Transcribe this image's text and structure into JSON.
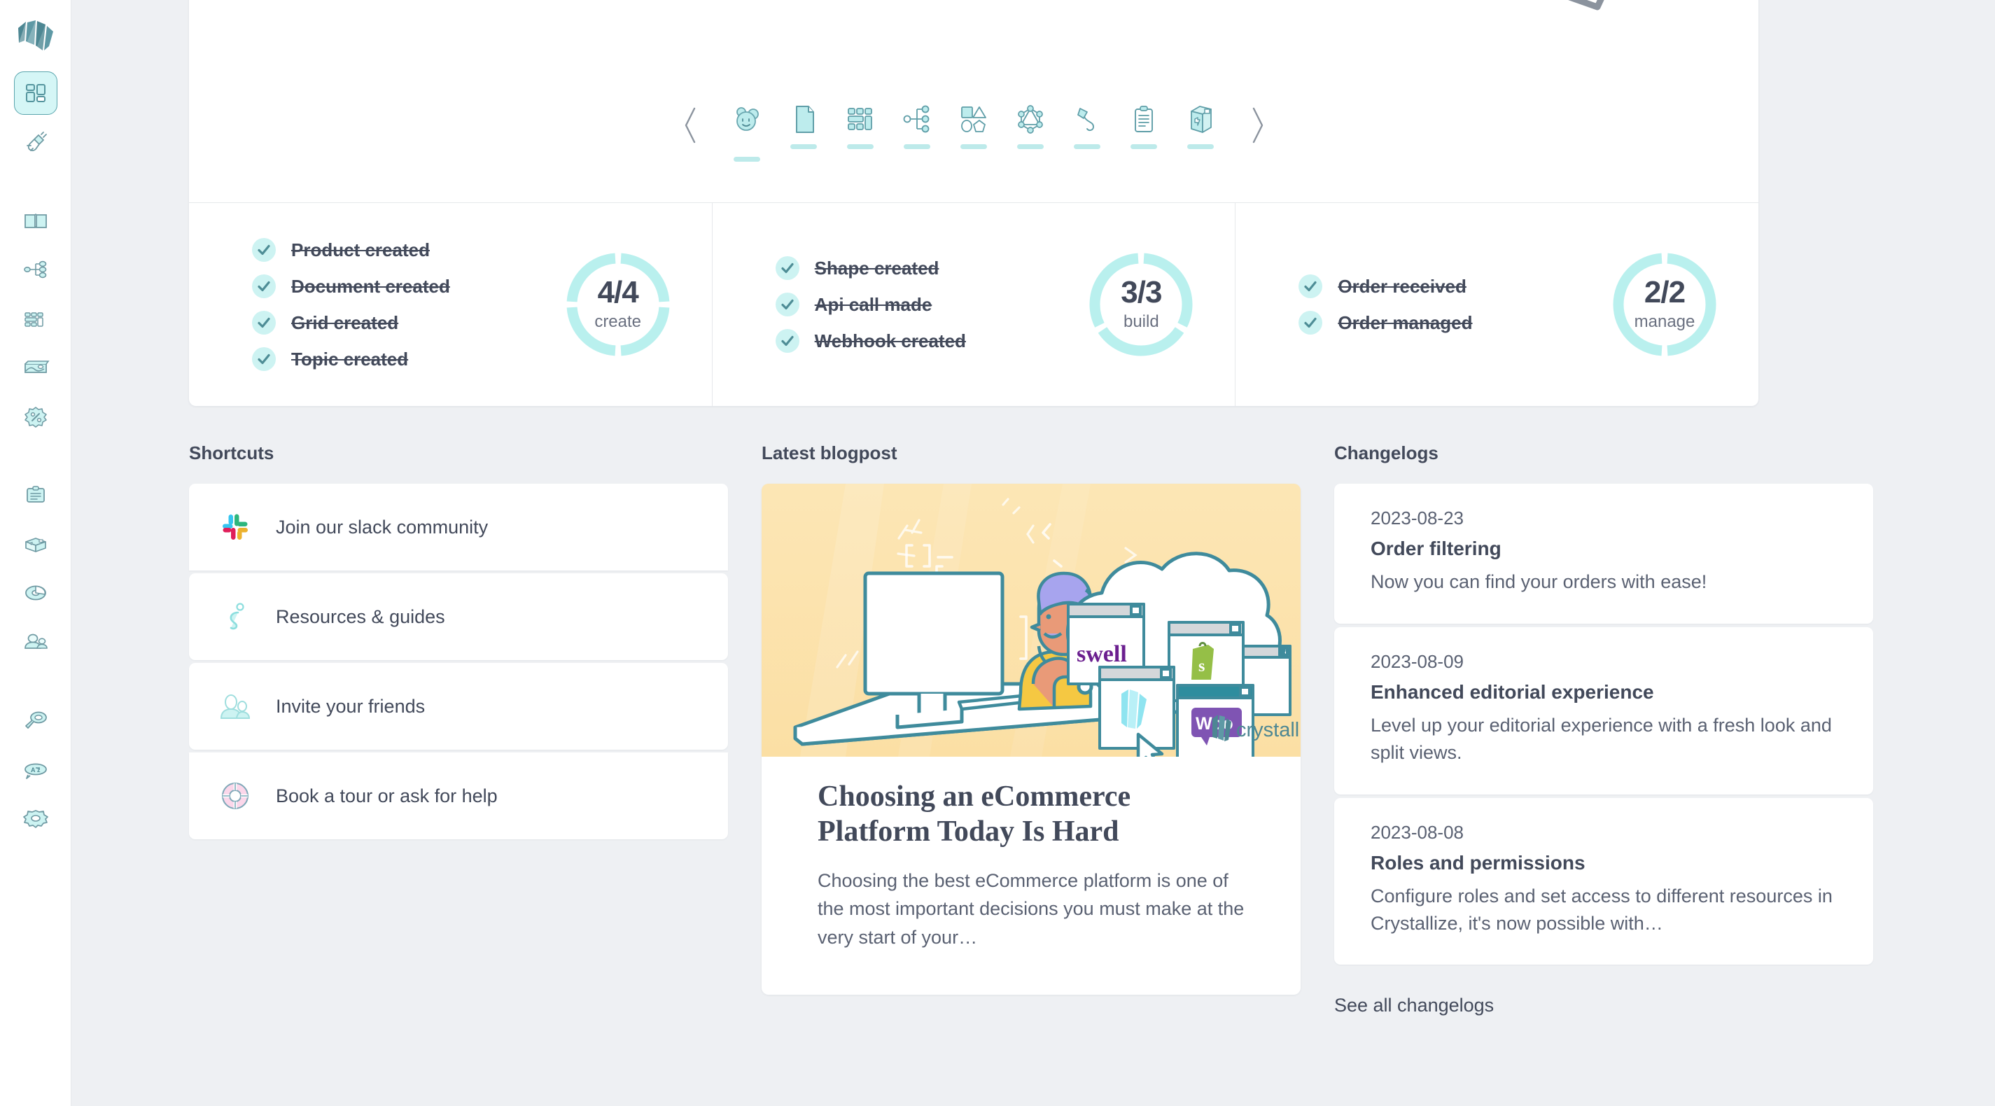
{
  "theme": {
    "page_bg": "#eef0f3",
    "card_bg": "#ffffff",
    "accent": "#7fd4d4",
    "accent_light": "#cdf3f2",
    "accent_dark": "#4f8f98",
    "text_dark": "#42495a",
    "text_muted": "#5a6172",
    "ring_filled": "#b9f0ee"
  },
  "sidebar": {
    "logo_name": "crystallize-logo",
    "items": [
      {
        "name": "dashboard",
        "icon": "dashboard-grid-icon",
        "active": true
      },
      {
        "name": "connections",
        "icon": "plug-icon",
        "active": false
      },
      {
        "name": "catalogue",
        "icon": "book-icon",
        "active": false
      },
      {
        "name": "topics",
        "icon": "topic-tree-icon",
        "active": false
      },
      {
        "name": "grids",
        "icon": "grid-layout-icon",
        "active": false
      },
      {
        "name": "media",
        "icon": "image-icon",
        "active": false
      },
      {
        "name": "discounts",
        "icon": "discount-badge-icon",
        "active": false
      },
      {
        "name": "orders",
        "icon": "clipboard-icon",
        "active": false
      },
      {
        "name": "shipping",
        "icon": "box-icon",
        "active": false
      },
      {
        "name": "analytics",
        "icon": "pie-chart-icon",
        "active": false
      },
      {
        "name": "customers",
        "icon": "people-icon",
        "active": false
      },
      {
        "name": "search",
        "icon": "magnifier-icon",
        "active": false
      },
      {
        "name": "translations",
        "icon": "language-az-icon",
        "active": false
      },
      {
        "name": "settings",
        "icon": "gear-icon",
        "active": false
      }
    ]
  },
  "onboarding": {
    "prev_label": "‹",
    "next_label": "›",
    "prev_icon": "chevron-left-icon",
    "next_icon": "chevron-right-icon",
    "tabs": [
      {
        "name": "product",
        "icon": "product-face-icon",
        "active": true
      },
      {
        "name": "document",
        "icon": "document-icon",
        "active": false
      },
      {
        "name": "grid",
        "icon": "grid-icon",
        "active": false
      },
      {
        "name": "topic",
        "icon": "topic-map-icon",
        "active": false
      },
      {
        "name": "shape",
        "icon": "shapes-icon",
        "active": false
      },
      {
        "name": "graphql",
        "icon": "graphql-icon",
        "active": false
      },
      {
        "name": "webhook",
        "icon": "hook-icon",
        "active": false
      },
      {
        "name": "order",
        "icon": "clipboard-order-icon",
        "active": false
      },
      {
        "name": "delivery",
        "icon": "package-box-icon",
        "active": false
      }
    ],
    "columns": [
      {
        "key": "create",
        "label": "create",
        "fraction": "4/4",
        "completed": 4,
        "total": 4,
        "tasks": [
          {
            "label": "Product created",
            "done": true
          },
          {
            "label": "Document created",
            "done": true
          },
          {
            "label": "Grid created",
            "done": true
          },
          {
            "label": "Topic created",
            "done": true
          }
        ]
      },
      {
        "key": "build",
        "label": "build",
        "fraction": "3/3",
        "completed": 3,
        "total": 3,
        "tasks": [
          {
            "label": "Shape created",
            "done": true
          },
          {
            "label": "Api call made",
            "done": true
          },
          {
            "label": "Webhook created",
            "done": true
          }
        ]
      },
      {
        "key": "manage",
        "label": "manage",
        "fraction": "2/2",
        "completed": 2,
        "total": 2,
        "tasks": [
          {
            "label": "Order received",
            "done": true
          },
          {
            "label": "Order managed",
            "done": true
          }
        ]
      }
    ]
  },
  "shortcuts": {
    "title": "Shortcuts",
    "items": [
      {
        "label": "Join our slack community",
        "icon": "slack-icon"
      },
      {
        "label": "Resources & guides",
        "icon": "question-mark-icon"
      },
      {
        "label": "Invite your friends",
        "icon": "people-icon"
      },
      {
        "label": "Book a tour or ask for help",
        "icon": "life-ring-icon"
      }
    ]
  },
  "blogpost": {
    "title": "Latest blogpost",
    "post_title": "Choosing an eCommerce Platform Today Is Hard",
    "excerpt": "Choosing the best eCommerce platform is one of the most important decisions you must make at the very start of your…",
    "image_alt": "illustration-man-at-desk-thinking-about-ecommerce-platforms",
    "image_logos": [
      "swell",
      "shopify",
      "crystallize",
      "woocommerce"
    ],
    "watermark": "crystallize"
  },
  "changelogs": {
    "title": "Changelogs",
    "see_all": "See all changelogs",
    "items": [
      {
        "date": "2023-08-23",
        "title": "Order filtering",
        "desc": "Now you can find your orders with ease!"
      },
      {
        "date": "2023-08-09",
        "title": "Enhanced editorial experience",
        "desc": "Level up your editorial experience with a fresh look and split views."
      },
      {
        "date": "2023-08-08",
        "title": "Roles and permissions",
        "desc": "Configure roles and set access to different resources in Crystallize, it's now possible with…"
      }
    ]
  }
}
